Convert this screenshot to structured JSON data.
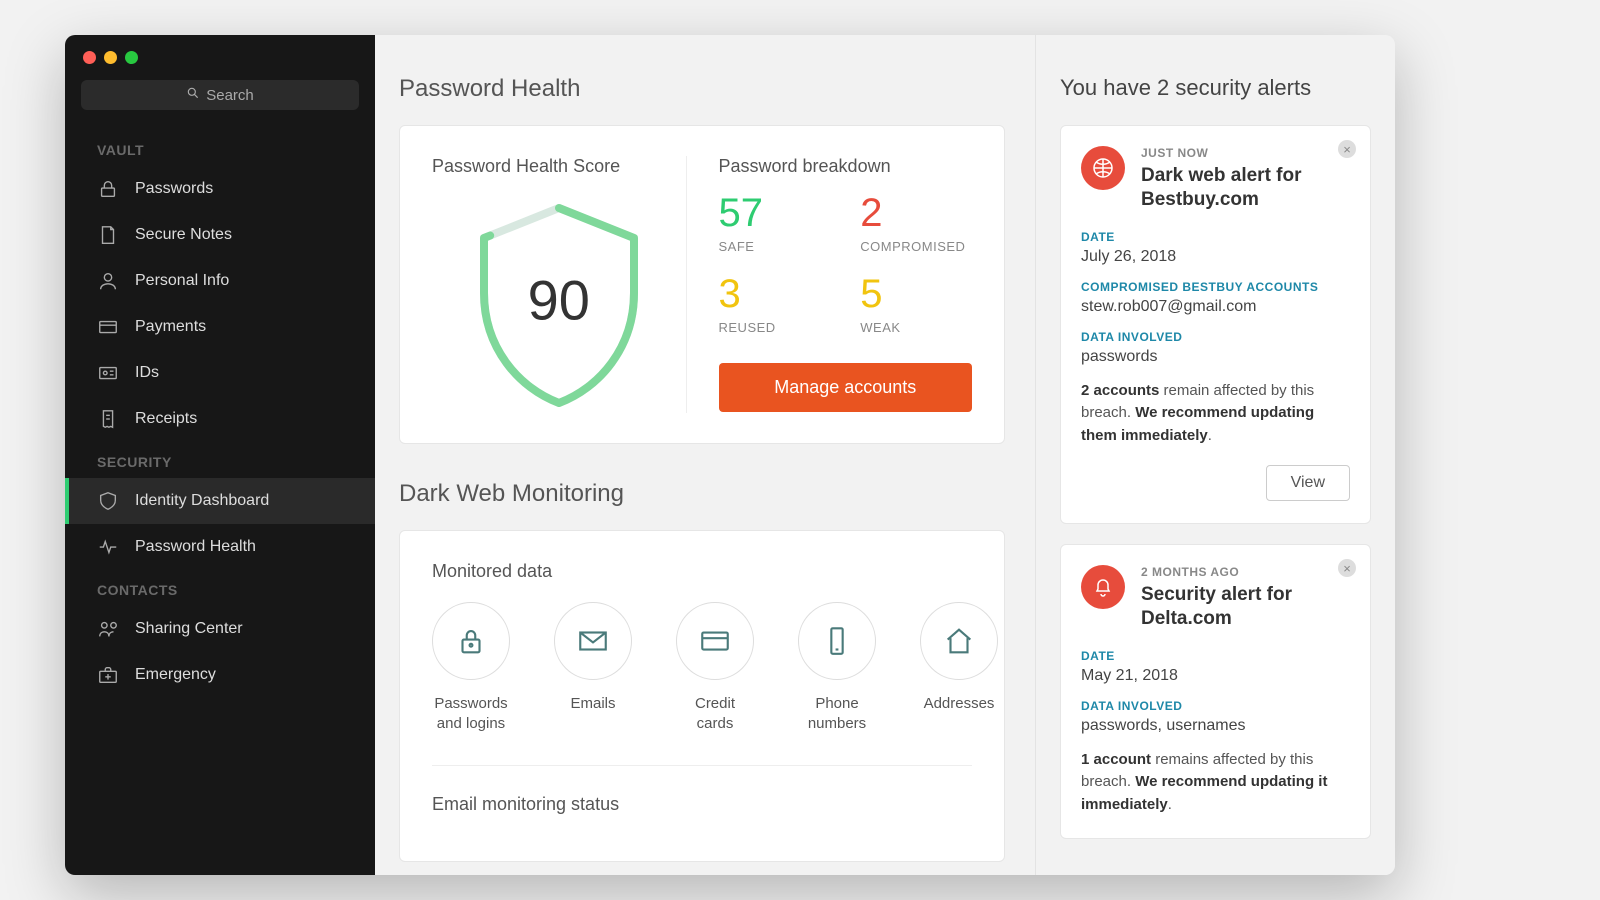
{
  "search": {
    "placeholder": "Search"
  },
  "sidebar": {
    "sections": [
      {
        "label": "VAULT",
        "items": [
          {
            "label": "Passwords",
            "icon": "lock-icon"
          },
          {
            "label": "Secure Notes",
            "icon": "note-icon"
          },
          {
            "label": "Personal Info",
            "icon": "person-icon"
          },
          {
            "label": "Payments",
            "icon": "card-icon"
          },
          {
            "label": "IDs",
            "icon": "id-icon"
          },
          {
            "label": "Receipts",
            "icon": "receipt-icon"
          }
        ]
      },
      {
        "label": "SECURITY",
        "items": [
          {
            "label": "Identity Dashboard",
            "icon": "shield-icon",
            "active": true
          },
          {
            "label": "Password Health",
            "icon": "pulse-icon"
          }
        ]
      },
      {
        "label": "CONTACTS",
        "items": [
          {
            "label": "Sharing Center",
            "icon": "share-icon"
          },
          {
            "label": "Emergency",
            "icon": "kit-icon"
          }
        ]
      }
    ]
  },
  "main": {
    "title": "Password Health",
    "health": {
      "score_label": "Password Health Score",
      "score": "90",
      "breakdown_label": "Password breakdown",
      "safe": {
        "value": "57",
        "label": "SAFE"
      },
      "compromised": {
        "value": "2",
        "label": "COMPROMISED"
      },
      "reused": {
        "value": "3",
        "label": "REUSED"
      },
      "weak": {
        "value": "5",
        "label": "WEAK"
      },
      "manage_label": "Manage accounts"
    },
    "darkweb": {
      "title": "Dark Web Monitoring",
      "monitored_label": "Monitored data",
      "items": [
        {
          "label": "Passwords and logins"
        },
        {
          "label": "Emails"
        },
        {
          "label": "Credit cards"
        },
        {
          "label": "Phone numbers"
        },
        {
          "label": "Addresses"
        }
      ],
      "email_status_label": "Email monitoring status"
    }
  },
  "alerts": {
    "title": "You have 2 security alerts",
    "items": [
      {
        "time": "JUST NOW",
        "title": "Dark web alert for Bestbuy.com",
        "date_label": "DATE",
        "date": "July 26, 2018",
        "accounts_label": "COMPROMISED BESTBUY ACCOUNTS",
        "accounts": "stew.rob007@gmail.com",
        "data_label": "DATA INVOLVED",
        "data": "passwords",
        "affected_count": "2 accounts",
        "affected_text": " remain affected by this breach. ",
        "recommend": "We recommend updating them immediately",
        "view_label": "View"
      },
      {
        "time": "2 MONTHS AGO",
        "title": "Security alert for Delta.com",
        "date_label": "DATE",
        "date": "May 21, 2018",
        "data_label": "DATA INVOLVED",
        "data": "passwords, usernames",
        "affected_count": "1 account",
        "affected_text": " remains affected by this breach. ",
        "recommend": "We recommend updating it immediately"
      }
    ]
  }
}
